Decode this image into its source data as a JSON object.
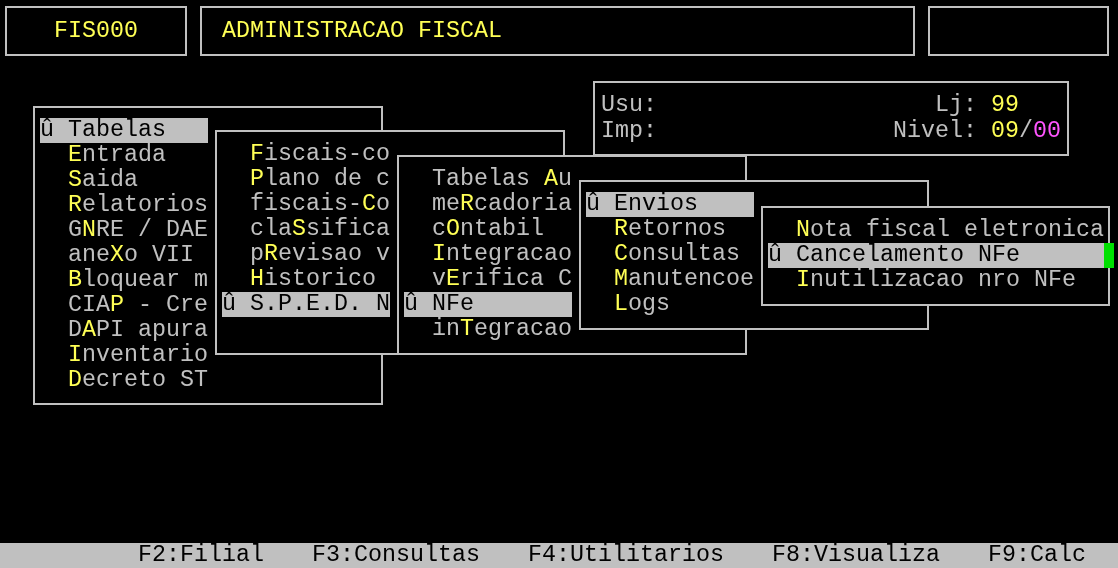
{
  "header": {
    "program_code": "FIS000",
    "title": "ADMINISTRACAO FISCAL"
  },
  "info": {
    "user_label": "Usu:",
    "printer_label": "Imp:",
    "store_label": "Lj:",
    "store": "99",
    "nivel_label": "Nivel:",
    "nivel_main": "09",
    "nivel_sep": "/",
    "nivel_sub": "00"
  },
  "menus": [
    {
      "items": [
        {
          "marker": "û",
          "before": "Tabelas",
          "selected": true
        },
        {
          "key": "E",
          "after": "ntrada",
          "selected": false
        },
        {
          "key": "S",
          "after": "aida",
          "selected": false
        },
        {
          "key": "R",
          "after": "elatorios",
          "selected": false
        },
        {
          "before": "G",
          "key": "N",
          "after": "RE / DAE",
          "selected": false
        },
        {
          "before": "ane",
          "key": "X",
          "after": "o VII",
          "selected": false
        },
        {
          "key": "B",
          "after": "loquear m",
          "selected": false
        },
        {
          "before": "CIA",
          "key": "P",
          "after": " - Cre",
          "selected": false
        },
        {
          "before": "D",
          "key": "A",
          "after": "PI apura",
          "selected": false
        },
        {
          "key": "I",
          "after": "nventario",
          "selected": false
        },
        {
          "key": "D",
          "after": "ecreto ST",
          "selected": false
        }
      ]
    },
    {
      "items": [
        {
          "key": "F",
          "after": "iscais-co",
          "selected": false
        },
        {
          "key": "P",
          "after": "lano de c",
          "selected": false
        },
        {
          "before": "fiscais-",
          "key": "C",
          "after": "o",
          "selected": false
        },
        {
          "before": "cla",
          "key": "S",
          "after": "sifica",
          "selected": false
        },
        {
          "before": "p",
          "key": "R",
          "after": "evisao v",
          "selected": false
        },
        {
          "key": "H",
          "after": "istorico",
          "selected": false
        },
        {
          "marker": "û",
          "before": "S.P.E.D. N",
          "selected": true
        }
      ]
    },
    {
      "items": [
        {
          "before": "Tabelas ",
          "key": "A",
          "after": "u",
          "selected": false
        },
        {
          "before": "me",
          "key": "R",
          "after": "cadoria",
          "selected": false
        },
        {
          "before": "c",
          "key": "O",
          "after": "ntabil",
          "selected": false
        },
        {
          "key": "I",
          "after": "ntegracao",
          "selected": false
        },
        {
          "before": "v",
          "key": "E",
          "after": "rifica C",
          "selected": false
        },
        {
          "marker": "û",
          "before": "NFe",
          "selected": true
        },
        {
          "before": "in",
          "key": "T",
          "after": "egracao",
          "selected": false
        }
      ]
    },
    {
      "items": [
        {
          "marker": "û",
          "before": "Envios",
          "selected": true
        },
        {
          "key": "R",
          "after": "etornos",
          "selected": false
        },
        {
          "key": "C",
          "after": "onsultas",
          "selected": false
        },
        {
          "key": "M",
          "after": "anutencoe",
          "selected": false
        },
        {
          "key": "L",
          "after": "ogs",
          "selected": false
        }
      ]
    },
    {
      "items": [
        {
          "key": "N",
          "after": "ota fiscal eletronica",
          "selected": false
        },
        {
          "marker": "û",
          "before": "Cancelamento NFe",
          "selected": true
        },
        {
          "key": "I",
          "after": "nutilizacao nro NFe",
          "selected": false
        }
      ]
    }
  ],
  "function_keys": [
    "F2:Filial",
    "F3:Consultas",
    "F4:Utilitarios",
    "F8:Visualiza",
    "F9:Calc"
  ]
}
